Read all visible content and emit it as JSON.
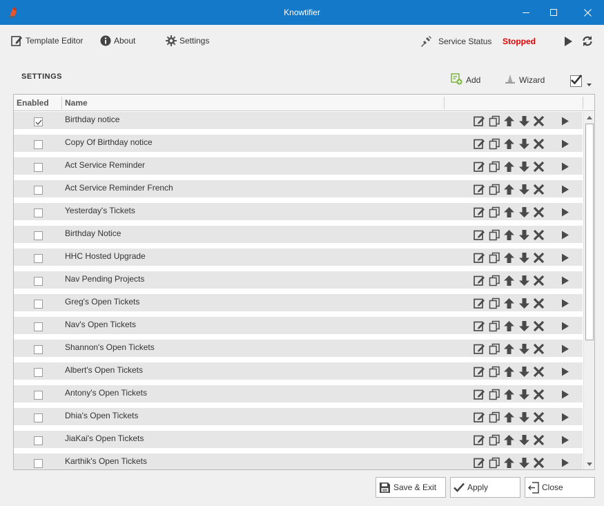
{
  "window": {
    "title": "Knowtifier",
    "controls": [
      "minimize-icon",
      "maximize-icon",
      "close-icon"
    ]
  },
  "toolbar": {
    "template_editor": "Template Editor",
    "about": "About",
    "settings": "Settings",
    "service_status_label": "Service Status",
    "service_status_value": "Stopped",
    "status_color": "#e00000"
  },
  "section": {
    "title": "SETTINGS",
    "add": "Add",
    "wizard": "Wizard"
  },
  "grid": {
    "columns": [
      "Enabled",
      "Name"
    ],
    "row_actions": [
      "edit-icon",
      "copy-icon",
      "move-up-icon",
      "move-down-icon",
      "delete-icon",
      "run-icon"
    ],
    "rows": [
      {
        "enabled": true,
        "name": "Birthday notice"
      },
      {
        "enabled": false,
        "name": "Copy Of Birthday notice"
      },
      {
        "enabled": false,
        "name": "Act Service Reminder"
      },
      {
        "enabled": false,
        "name": "Act Service Reminder French"
      },
      {
        "enabled": false,
        "name": "Yesterday's Tickets"
      },
      {
        "enabled": false,
        "name": "Birthday Notice"
      },
      {
        "enabled": false,
        "name": "HHC Hosted Upgrade"
      },
      {
        "enabled": false,
        "name": "Nav Pending Projects"
      },
      {
        "enabled": false,
        "name": "Greg's Open Tickets"
      },
      {
        "enabled": false,
        "name": "Nav's Open Tickets"
      },
      {
        "enabled": false,
        "name": "Shannon's Open Tickets"
      },
      {
        "enabled": false,
        "name": "Albert's Open Tickets"
      },
      {
        "enabled": false,
        "name": "Antony's Open Tickets"
      },
      {
        "enabled": false,
        "name": "Dhia's Open Tickets"
      },
      {
        "enabled": false,
        "name": "JiaKai's Open Tickets"
      },
      {
        "enabled": false,
        "name": "Karthik's Open Tickets"
      }
    ]
  },
  "footer": {
    "save_exit": "Save & Exit",
    "apply": "Apply",
    "close": "Close"
  },
  "colors": {
    "titlebar": "#1479c9",
    "row_band": "#e6e6e6",
    "add_icon": "#7cb342"
  }
}
